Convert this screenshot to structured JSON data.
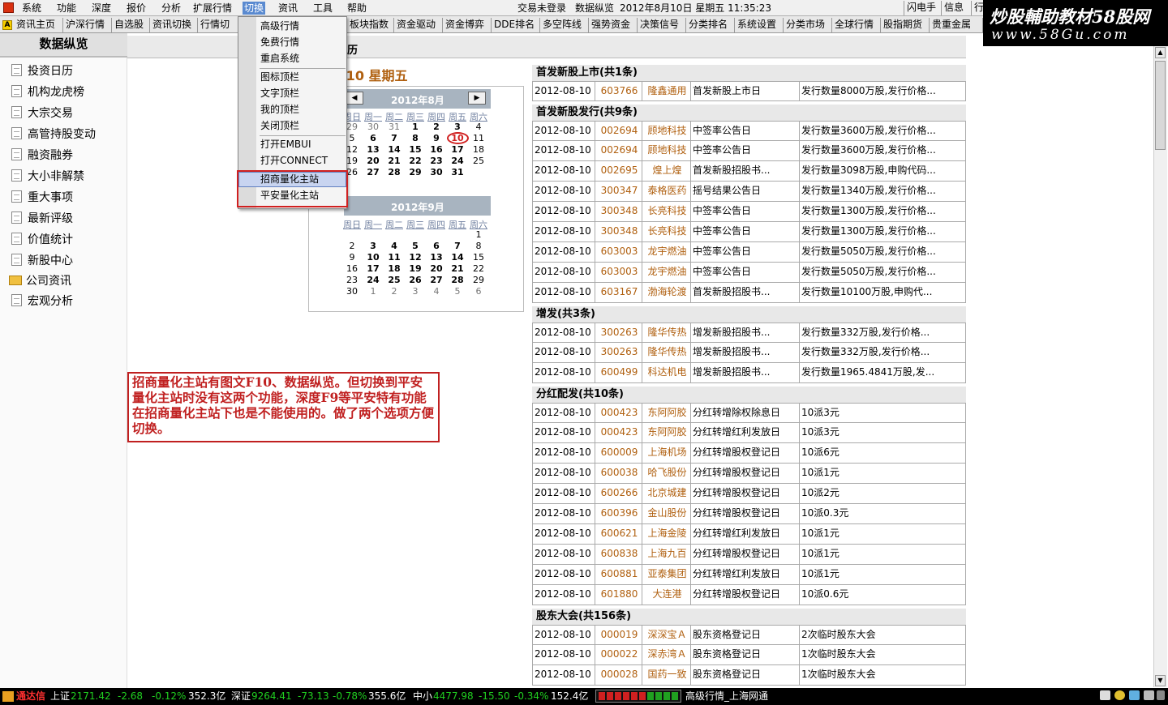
{
  "menubar": {
    "items": [
      "系统",
      "功能",
      "深度",
      "报价",
      "分析",
      "扩展行情",
      "切换",
      "资讯",
      "工具",
      "帮助"
    ],
    "status": "交易未登录",
    "center_title": "数据纵览",
    "datetime": "2012年8月10日  星期五  11:35:23",
    "right_buttons": [
      "闪电手",
      "信息",
      "行"
    ]
  },
  "toolbar": {
    "tabs": [
      "资讯主页",
      "沪深行情",
      "自选股",
      "资讯切换",
      "行情切",
      "板块指数",
      "资金驱动",
      "资金博弈",
      "DDE排名",
      "多空阵线",
      "强势资金",
      "决策信号",
      "分类排名",
      "系统设置",
      "分类市场",
      "全球行情",
      "股指期货",
      "贵重金属"
    ]
  },
  "watermark": {
    "line1": "炒股輔助教材58股网",
    "line2": "www.58Gu.com"
  },
  "sidebar": {
    "title": "数据纵览",
    "items": [
      "投资日历",
      "机构龙虎榜",
      "大宗交易",
      "高管持股变动",
      "融资融券",
      "大小非解禁",
      "重大事项",
      "最新评级",
      "价值统计",
      "新股中心",
      "公司资讯",
      "宏观分析"
    ]
  },
  "content": {
    "header": "历",
    "date_heading": "2-08-10  星期五"
  },
  "dropdown": {
    "items": [
      "高级行情",
      "免费行情",
      "重启系统",
      "图标顶栏",
      "文字顶栏",
      "我的顶栏",
      "关闭顶栏",
      "打开EMBUI",
      "打开CONNECT",
      "招商量化主站",
      "平安量化主站"
    ]
  },
  "note": "招商量化主站有图文F10、数据纵览。但切换到平安量化主站时没有这两个功能，深度F9等平安特有功能在招商量化主站下也是不能使用的。做了两个选项方便切换。",
  "calendar": {
    "weekdays": [
      "周日",
      "周一",
      "周二",
      "周三",
      "周四",
      "周五",
      "周六"
    ],
    "months": [
      {
        "title": "2012年8月",
        "nav_prev": "◀",
        "nav_next": "▶",
        "today": "10",
        "rows": [
          [
            "29",
            "30",
            "31",
            "1",
            "2",
            "3",
            "4"
          ],
          [
            "5",
            "6",
            "7",
            "8",
            "9",
            "10",
            "11"
          ],
          [
            "12",
            "13",
            "14",
            "15",
            "16",
            "17",
            "18"
          ],
          [
            "19",
            "20",
            "21",
            "22",
            "23",
            "24",
            "25"
          ],
          [
            "26",
            "27",
            "28",
            "29",
            "30",
            "31",
            ""
          ]
        ]
      },
      {
        "title": "2012年9月",
        "rows": [
          [
            "",
            "",
            "",
            "",
            "",
            "",
            "1"
          ],
          [
            "2",
            "3",
            "4",
            "5",
            "6",
            "7",
            "8"
          ],
          [
            "9",
            "10",
            "11",
            "12",
            "13",
            "14",
            "15"
          ],
          [
            "16",
            "17",
            "18",
            "19",
            "20",
            "21",
            "22"
          ],
          [
            "23",
            "24",
            "25",
            "26",
            "27",
            "28",
            "29"
          ],
          [
            "30",
            "1",
            "2",
            "3",
            "4",
            "5",
            "6"
          ]
        ]
      }
    ]
  },
  "sections": [
    {
      "title": "首发新股上市(共1条)",
      "rows": [
        [
          "2012-08-10",
          "603766",
          "隆鑫通用",
          "首发新股上市日",
          "发行数量8000万股,发行价格..."
        ]
      ]
    },
    {
      "title": "首发新股发行(共9条)",
      "rows": [
        [
          "2012-08-10",
          "002694",
          "顾地科技",
          "中签率公告日",
          "发行数量3600万股,发行价格..."
        ],
        [
          "2012-08-10",
          "002694",
          "顾地科技",
          "中签率公告日",
          "发行数量3600万股,发行价格..."
        ],
        [
          "2012-08-10",
          "002695",
          "煌上煌",
          "首发新股招股书...",
          "发行数量3098万股,申购代码..."
        ],
        [
          "2012-08-10",
          "300347",
          "泰格医药",
          "摇号结果公告日",
          "发行数量1340万股,发行价格..."
        ],
        [
          "2012-08-10",
          "300348",
          "长亮科技",
          "中签率公告日",
          "发行数量1300万股,发行价格..."
        ],
        [
          "2012-08-10",
          "300348",
          "长亮科技",
          "中签率公告日",
          "发行数量1300万股,发行价格..."
        ],
        [
          "2012-08-10",
          "603003",
          "龙宇燃油",
          "中签率公告日",
          "发行数量5050万股,发行价格..."
        ],
        [
          "2012-08-10",
          "603003",
          "龙宇燃油",
          "中签率公告日",
          "发行数量5050万股,发行价格..."
        ],
        [
          "2012-08-10",
          "603167",
          "渤海轮渡",
          "首发新股招股书...",
          "发行数量10100万股,申购代..."
        ]
      ]
    },
    {
      "title": "增发(共3条)",
      "rows": [
        [
          "2012-08-10",
          "300263",
          "隆华传热",
          "增发新股招股书...",
          "发行数量332万股,发行价格..."
        ],
        [
          "2012-08-10",
          "300263",
          "隆华传热",
          "增发新股招股书...",
          "发行数量332万股,发行价格..."
        ],
        [
          "2012-08-10",
          "600499",
          "科达机电",
          "增发新股招股书...",
          "发行数量1965.4841万股,发..."
        ]
      ]
    },
    {
      "title": "分红配发(共10条)",
      "rows": [
        [
          "2012-08-10",
          "000423",
          "东阿阿胶",
          "分红转增除权除息日",
          "10派3元"
        ],
        [
          "2012-08-10",
          "000423",
          "东阿阿胶",
          "分红转增红利发放日",
          "10派3元"
        ],
        [
          "2012-08-10",
          "600009",
          "上海机场",
          "分红转增股权登记日",
          "10派6元"
        ],
        [
          "2012-08-10",
          "600038",
          "哈飞股份",
          "分红转增股权登记日",
          "10派1元"
        ],
        [
          "2012-08-10",
          "600266",
          "北京城建",
          "分红转增股权登记日",
          "10派2元"
        ],
        [
          "2012-08-10",
          "600396",
          "金山股份",
          "分红转增股权登记日",
          "10派0.3元"
        ],
        [
          "2012-08-10",
          "600621",
          "上海金陵",
          "分红转增红利发放日",
          "10派1元"
        ],
        [
          "2012-08-10",
          "600838",
          "上海九百",
          "分红转增股权登记日",
          "10派1元"
        ],
        [
          "2012-08-10",
          "600881",
          "亚泰集团",
          "分红转增红利发放日",
          "10派1元"
        ],
        [
          "2012-08-10",
          "601880",
          "大连港",
          "分红转增股权登记日",
          "10派0.6元"
        ]
      ]
    },
    {
      "title": "股东大会(共156条)",
      "rows": [
        [
          "2012-08-10",
          "000019",
          "深深宝Ａ",
          "股东资格登记日",
          "2次临时股东大会"
        ],
        [
          "2012-08-10",
          "000022",
          "深赤湾Ａ",
          "股东资格登记日",
          "1次临时股东大会"
        ],
        [
          "2012-08-10",
          "000028",
          "国药一致",
          "股东资格登记日",
          "1次临时股东大会"
        ]
      ]
    }
  ],
  "statusbar": {
    "brand": "通达信",
    "sh": {
      "label": "上证",
      "index": "2171.42",
      "change": "-2.68",
      "pct": "-0.12%",
      "amount": "352.3亿"
    },
    "sz": {
      "label": "深证",
      "index": "9264.41",
      "change": "-73.13",
      "pct": "-0.78%",
      "amount": "355.6亿"
    },
    "zx": {
      "label": "中小",
      "index": "4477.98",
      "change": "-15.50",
      "pct": "-0.34%",
      "amount": "152.4亿"
    },
    "info": "高级行情_上海网通"
  },
  "colors": {
    "accent_brown": "#b06010",
    "highlight_red": "#d02020",
    "down_green": "#20d020"
  }
}
